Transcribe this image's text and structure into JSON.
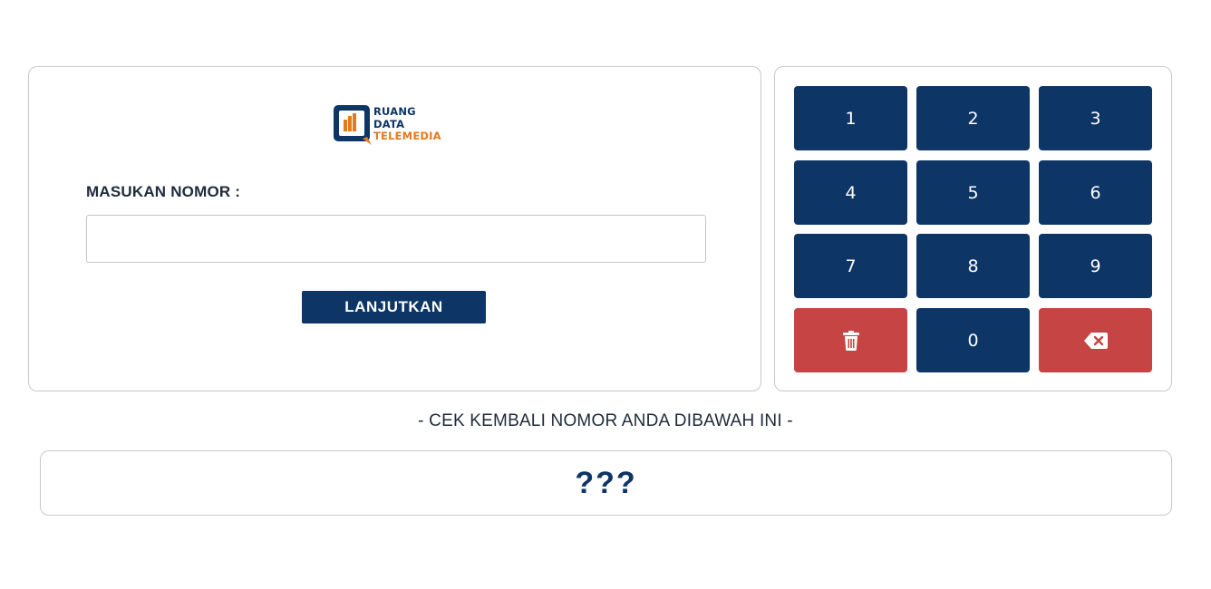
{
  "logo": {
    "line1": "RUANG",
    "line2": "DATA",
    "line3": "TELEMEDIA"
  },
  "form": {
    "label": "MASUKAN NOMOR :",
    "input_value": "",
    "input_placeholder": "",
    "submit_label": "LANJUTKAN"
  },
  "keypad": {
    "keys": [
      "1",
      "2",
      "3",
      "4",
      "5",
      "6",
      "7",
      "8",
      "9",
      "0"
    ],
    "clear_icon": "trash-icon",
    "backspace_icon": "backspace-icon"
  },
  "check": {
    "label": "- CEK KEMBALI NOMOR ANDA DIBAWAH INI -",
    "value": "???"
  },
  "colors": {
    "primary": "#0d3565",
    "accent": "#e47a1c",
    "danger": "#c64444"
  }
}
